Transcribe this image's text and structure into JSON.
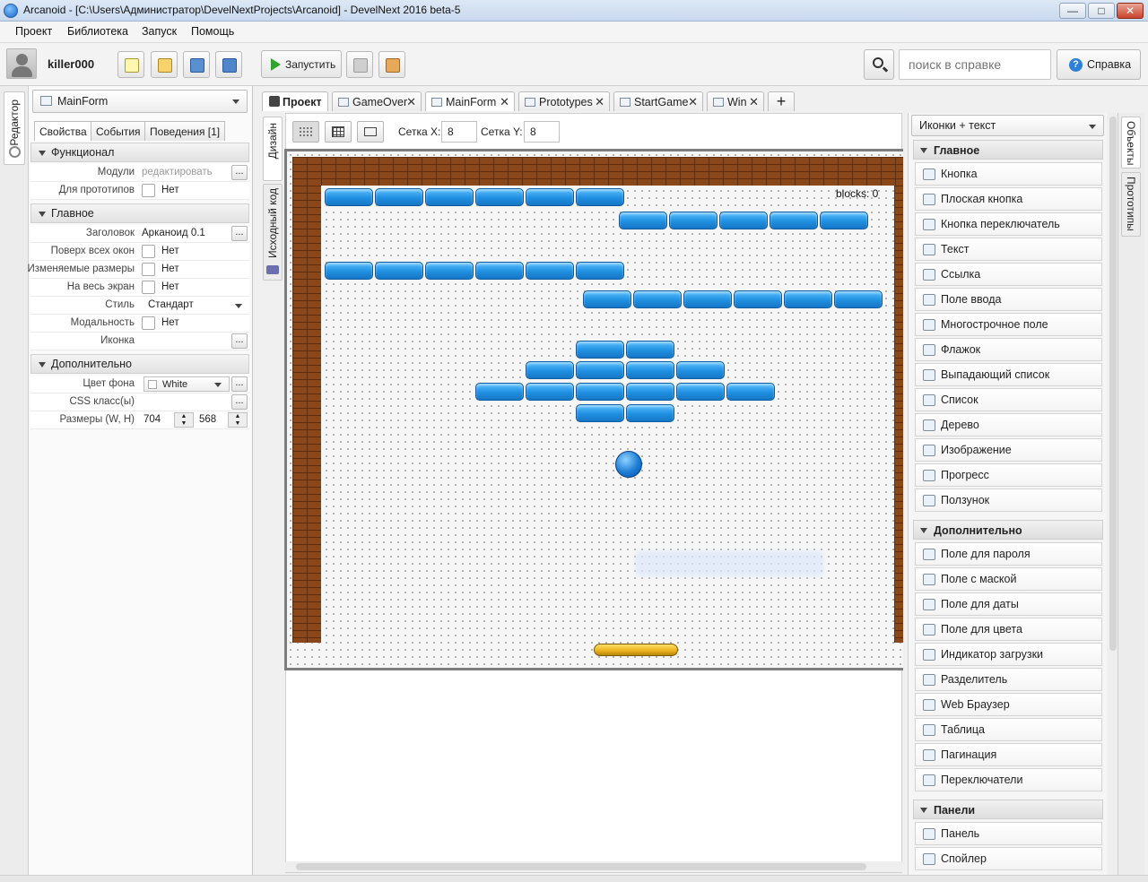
{
  "window": {
    "title": "Arcanoid - [C:\\Users\\Администратор\\DevelNextProjects\\Arcanoid] - DevelNext 2016 beta-5",
    "min": "—",
    "max": "□",
    "close": "✕"
  },
  "menu": [
    "Проект",
    "Библиотека",
    "Запуск",
    "Помощь"
  ],
  "toolbar": {
    "user": "killer000",
    "run_label": "Запустить",
    "search_placeholder": "поиск в справке",
    "help_label": "Справка"
  },
  "left_strip": {
    "editor_tab": "Редактор"
  },
  "props": {
    "form_select": "MainForm",
    "tabs": [
      "Свойства",
      "События",
      "Поведения [1]"
    ],
    "functional": {
      "title": "Функционал",
      "modules_label": "Модули",
      "modules_value": "редактировать",
      "prototypes_label": "Для прототипов",
      "prototypes_value": "Нет"
    },
    "main": {
      "title": "Главное",
      "caption_label": "Заголовок",
      "caption_value": "Арканоид 0.1",
      "ontop_label": "Поверх всех окон",
      "ontop_value": "Нет",
      "resizable_label": "Изменяемые размеры",
      "resizable_value": "Нет",
      "fullscreen_label": "На весь экран",
      "fullscreen_value": "Нет",
      "style_label": "Стиль",
      "style_value": "Стандарт",
      "modal_label": "Модальность",
      "modal_value": "Нет",
      "icon_label": "Иконка"
    },
    "extra": {
      "title": "Дополнительно",
      "bg_label": "Цвет фона",
      "bg_value": "White",
      "css_label": "CSS класс(ы)",
      "size_label": "Размеры (W, H)",
      "width": "704",
      "height": "568"
    },
    "dots": "..."
  },
  "editor": {
    "tabs": [
      "Проект",
      "GameOver",
      "MainForm",
      "Prototypes",
      "StartGame",
      "Win"
    ],
    "add_tab": "+",
    "side_tabs": [
      "Дизайн",
      "Исходный код"
    ],
    "grid_x_label": "Сетка X:",
    "grid_x": "8",
    "grid_y_label": "Сетка Y:",
    "grid_y": "8",
    "blocks_label": "blocks: 0"
  },
  "palette": {
    "view_select": "Иконки + текст",
    "sections": [
      {
        "title": "Главное",
        "items": [
          "Кнопка",
          "Плоская кнопка",
          "Кнопка переключатель",
          "Текст",
          "Ссылка",
          "Поле ввода",
          "Многострочное поле",
          "Флажок",
          "Выпадающий список",
          "Список",
          "Дерево",
          "Изображение",
          "Прогресс",
          "Ползунок"
        ]
      },
      {
        "title": "Дополнительно",
        "items": [
          "Поле для пароля",
          "Поле с маской",
          "Поле для даты",
          "Поле для цвета",
          "Индикатор загрузки",
          "Разделитель",
          "Web Браузер",
          "Таблица",
          "Пагинация",
          "Переключатели"
        ]
      },
      {
        "title": "Панели",
        "items": [
          "Панель",
          "Спойлер"
        ]
      }
    ],
    "right_tabs": [
      "Объекты",
      "Прототипы"
    ]
  }
}
